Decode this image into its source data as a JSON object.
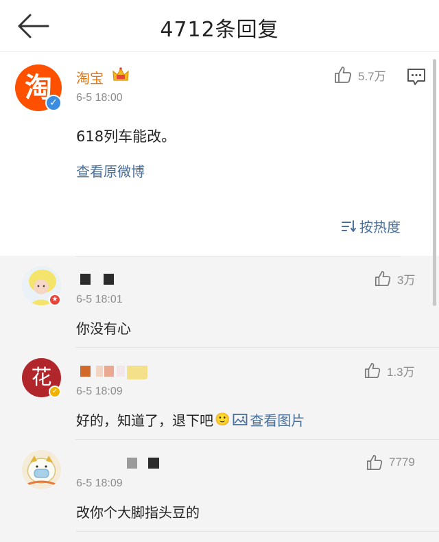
{
  "header": {
    "title": "4712条回复"
  },
  "main_post": {
    "avatar_text": "淘",
    "username": "淘宝",
    "time": "6-5 18:00",
    "likes": "5.7万",
    "content": "618列车能改。",
    "view_original": "查看原微博",
    "sort_label": "按热度"
  },
  "replies": [
    {
      "time": "6-5 18:01",
      "likes": "3万",
      "content": "你没有心"
    },
    {
      "avatar_text": "花",
      "time": "6-5 18:09",
      "likes": "1.3万",
      "content": "好的，知道了，退下吧",
      "emoji": "🙂",
      "view_image": "查看图片"
    },
    {
      "time": "6-5 18:09",
      "likes": "7779",
      "content": "改你个大脚指头豆的"
    }
  ],
  "colors": {
    "brand_orange": "#ff5000",
    "username_orange": "#e8740c",
    "link_blue": "#4a6f9a",
    "verified_blue": "#3b8de0",
    "verified_gold": "#f0b400",
    "verified_red": "#e8463b"
  }
}
